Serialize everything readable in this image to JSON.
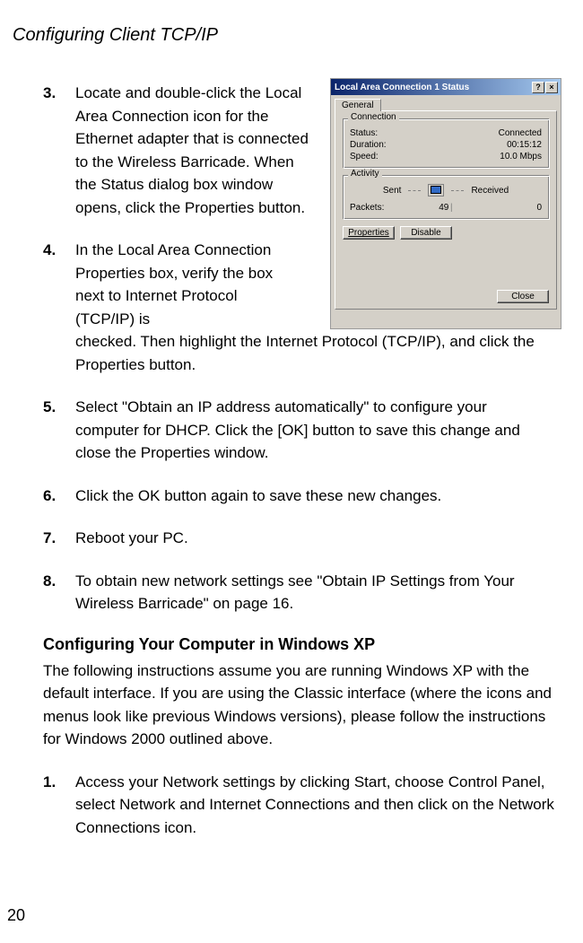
{
  "header": "Configuring Client TCP/IP",
  "steps": [
    {
      "num": "3.",
      "text": "Locate and double-click the Local Area Connection icon for the Ethernet adapter that is connected to the Wireless Barricade. When the Status dialog box window opens, click the Properties button."
    },
    {
      "num": "4.",
      "text": "In the Local Area Connection Properties box, verify the box next to Internet Protocol (TCP/IP) is checked. Then highlight the Internet Protocol (TCP/IP), and click the Properties button."
    },
    {
      "num": "5.",
      "text": "Select \"Obtain an IP address automatically\" to configure your computer for DHCP. Click the [OK] button to save this change and close the Properties window."
    },
    {
      "num": "6.",
      "text": "Click the OK button again to save these new changes."
    },
    {
      "num": "7.",
      "text": "Reboot your PC."
    },
    {
      "num": "8.",
      "text": "To obtain new network settings see \"Obtain IP Settings from Your Wireless Barricade\" on page 16."
    }
  ],
  "dialog": {
    "title": "Local Area Connection 1 Status",
    "tab": "General",
    "connection": {
      "label": "Connection",
      "status_label": "Status:",
      "status_value": "Connected",
      "duration_label": "Duration:",
      "duration_value": "00:15:12",
      "speed_label": "Speed:",
      "speed_value": "10.0 Mbps"
    },
    "activity": {
      "label": "Activity",
      "sent_label": "Sent",
      "received_label": "Received",
      "packets_label": "Packets:",
      "sent_value": "49",
      "received_value": "0"
    },
    "buttons": {
      "properties": "Properties",
      "disable": "Disable",
      "close": "Close"
    },
    "help": "?",
    "x": "×"
  },
  "section": {
    "heading": "Configuring Your Computer in Windows XP",
    "para": "The following instructions assume you are running Windows XP with the default interface. If you are using the Classic interface (where the icons and menus look like previous Windows versions), please follow the instructions for Windows 2000 outlined above."
  },
  "substeps": [
    {
      "num": "1.",
      "text": "Access your Network settings by clicking Start, choose Control Panel, select Network and Internet Connections and then click on the Network Connections icon."
    }
  ],
  "page_num": "20"
}
